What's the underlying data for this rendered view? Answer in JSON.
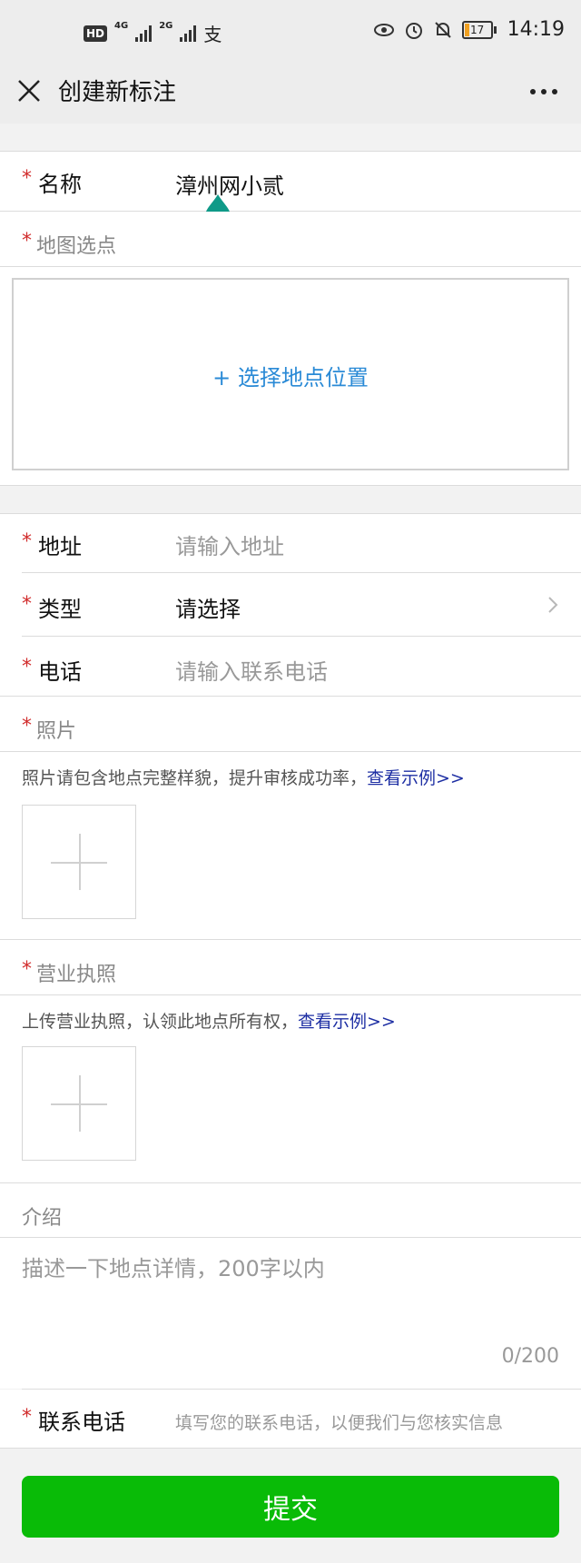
{
  "status_bar": {
    "hd": "HD",
    "network_1": "4G",
    "network_2": "2G",
    "alipay": "支",
    "battery": "17",
    "time": "14:19"
  },
  "nav": {
    "title": "创建新标注"
  },
  "form": {
    "name_label": "名称",
    "name_value": "漳州网小贰",
    "map_label": "地图选点",
    "map_action": "+ 选择地点位置",
    "address_label": "地址",
    "address_placeholder": "请输入地址",
    "type_label": "类型",
    "type_value": "请选择",
    "phone_label": "电话",
    "phone_placeholder": "请输入联系电话",
    "photo_label": "照片",
    "photo_note": "照片请包含地点完整样貌，提升审核成功率，",
    "photo_link": "查看示例>>",
    "license_label": "营业执照",
    "license_note": "上传营业执照，认领此地点所有权，",
    "license_link": "查看示例>>",
    "intro_label": "介绍",
    "intro_placeholder": "描述一下地点详情，200字以内",
    "intro_count": "0/200",
    "contact_label": "联系电话",
    "contact_placeholder": "填写您的联系电话，以便我们与您核实信息",
    "required_mark": "*"
  },
  "submit_label": "提交",
  "colors": {
    "accent_green": "#09bb07",
    "link_blue": "#1d2ea3",
    "map_blue": "#2a8ad6",
    "required_red": "#d12c2c",
    "cursor_teal": "#0f9a88"
  }
}
